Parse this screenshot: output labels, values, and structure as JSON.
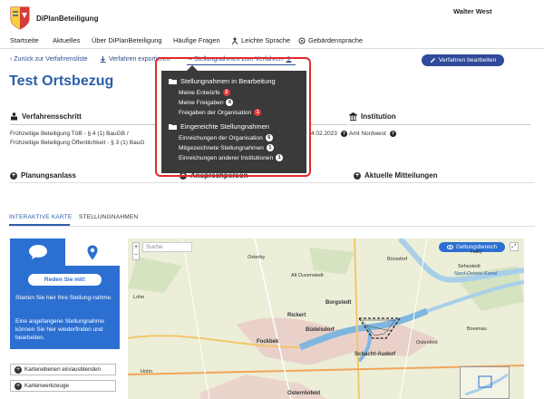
{
  "app": {
    "brand": "DiPlanBeteiligung",
    "user": "Walter West"
  },
  "nav": {
    "items": [
      {
        "label": "Startseite"
      },
      {
        "label": "Aktuelles"
      },
      {
        "label": "Über DiPlanBeteiligung"
      },
      {
        "label": "Häufige Fragen"
      },
      {
        "label": "Leichte Sprache"
      },
      {
        "label": "Gebärdensprache"
      }
    ]
  },
  "toolbar": {
    "back": "‹ Zurück zur Verfahrensliste",
    "export": "Verfahren exportieren",
    "stellungnahmen": "– Stellungnahmen zum Verfahren",
    "edit": "Verfahren bearbeiten"
  },
  "page": {
    "title": "Test Ortsbezug"
  },
  "sections": {
    "verfahrensschritt": "Verfahrensschritt",
    "institution": "Institution",
    "schritt_line1": "Frühzeitige Beteiligung TöB - § 4 (1) BauGB /",
    "schritt_line2": "Frühzeitige Beteiligung Öffentlichkeit - § 3 (1) BauG",
    "date": "4.02.2023",
    "institution_value": "Amt Nordwest",
    "planungsanlass": "Planungsanlass",
    "ansprechperson": "Ansprechperson",
    "mitteilungen": "Aktuelle Mitteilungen"
  },
  "tabs": [
    {
      "label": "INTERAKTIVE KARTE"
    },
    {
      "label": "STELLUNGNAHMEN"
    }
  ],
  "panel": {
    "button": "Reden Sie mit!",
    "text1": "Starten Sie hier Ihre Stellung-nahme.",
    "text2": "Eine angefangene Stellungnahme können Sie hier wiederfinden und bearbeiten.",
    "layers_btn": "Kartenebenen ein/ausblenden",
    "tools_btn": "Kartenwerkzeuge"
  },
  "map": {
    "search_placeholder": "Suche",
    "geltungsbereich": "Geltungsbereich",
    "zoom_in": "+",
    "zoom_out": "−",
    "labels": [
      "Alt Duvenstedt",
      "Borgstedt",
      "Büdelsdorf",
      "Rickert",
      "Fockbek",
      "Osterrönfeld",
      "Schacht-Audorf",
      "Hohn",
      "Bovenau",
      "Sehestedt",
      "Nord-Ostsee-Kanal",
      "Osterby",
      "Ostenfeld",
      "Bünsdorf",
      "Haby",
      "Lohe"
    ]
  },
  "dropdown": {
    "group1": "Stellungnahmen in Bearbeitung",
    "group1_items": [
      {
        "label": "Meine Entwürfe",
        "count": "2"
      },
      {
        "label": "Meine Freigaben",
        "count": "6"
      },
      {
        "label": "Freigaben der Organisation",
        "count": "1"
      }
    ],
    "group2": "Eingereichte Stellungnahmen",
    "group2_items": [
      {
        "label": "Einreichungen der Organisation",
        "count": "6"
      },
      {
        "label": "Mitgezeichnete Stellungnahmen",
        "count": "1"
      },
      {
        "label": "Einreichungen anderer Institutionen",
        "count": "1"
      }
    ]
  },
  "colors": {
    "brand_blue": "#2b5ea8",
    "button_blue": "#2f4a9a",
    "panel_blue": "#2b6fd1",
    "highlight_red": "#e02b2b"
  }
}
